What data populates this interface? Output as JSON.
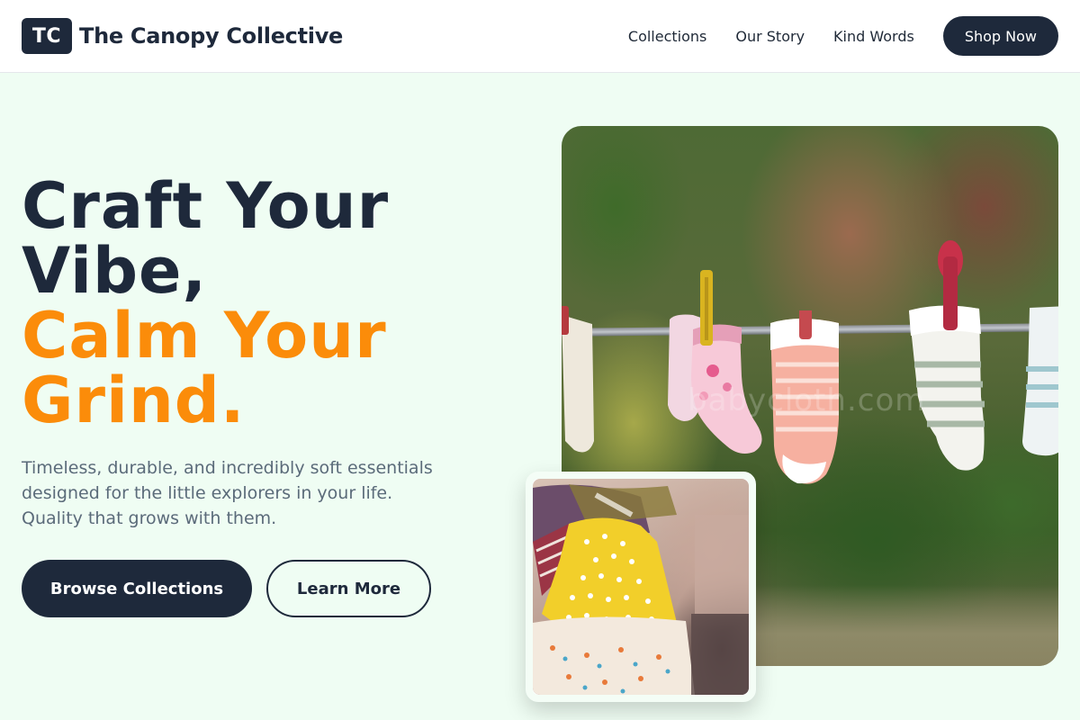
{
  "brand": {
    "initials": "TC",
    "name": "The Canopy Collective"
  },
  "nav": {
    "links": [
      "Collections",
      "Our Story",
      "Kind Words"
    ],
    "cta": "Shop Now"
  },
  "hero": {
    "title_line1": "Craft Your Vibe,",
    "title_line2": "Calm Your Grind.",
    "description": "Timeless, durable, and incredibly soft essentials designed for the little explorers in your life. Quality that grows with them.",
    "primary_button": "Browse Collections",
    "secondary_button": "Learn More"
  },
  "images": {
    "main_alt": "baby-socks-on-clothesline",
    "inset_alt": "kids-dresses-on-hangers"
  },
  "colors": {
    "navy": "#1e293b",
    "accent_orange": "#fb8c0a",
    "background_mint": "#effdf3"
  }
}
